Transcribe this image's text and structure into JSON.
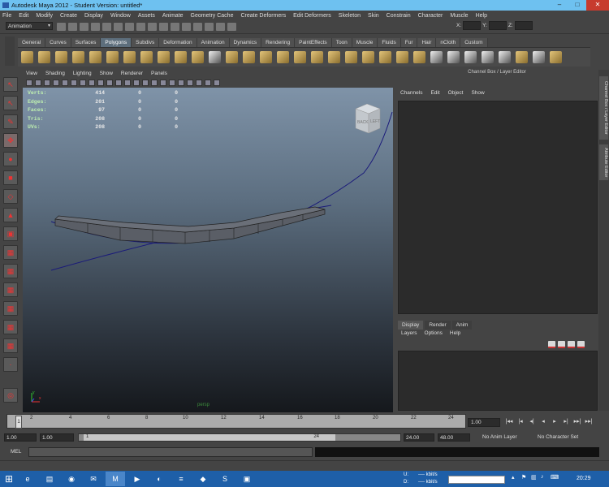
{
  "window": {
    "title": "Autodesk Maya 2012 - Student Version: untitled*",
    "min": "–",
    "max": "□",
    "close": "✕"
  },
  "menubar": [
    "File",
    "Edit",
    "Modify",
    "Create",
    "Display",
    "Window",
    "Assets",
    "Animate",
    "Geometry Cache",
    "Create Deformers",
    "Edit Deformers",
    "Skeleton",
    "Skin",
    "Constrain",
    "Character",
    "Muscle",
    "Help"
  ],
  "status": {
    "menu_set": "Animation",
    "x_label": "X:",
    "y_label": "Y:",
    "z_label": "Z:"
  },
  "shelf_tabs": [
    "General",
    "Curves",
    "Surfaces",
    "Polygons",
    "Subdivs",
    "Deformation",
    "Animation",
    "Dynamics",
    "Rendering",
    "PaintEffects",
    "Toon",
    "Muscle",
    "Fluids",
    "Fur",
    "Hair",
    "nCloth",
    "Custom"
  ],
  "shelf_active": "Polygons",
  "viewport": {
    "menu": [
      "View",
      "Shading",
      "Lighting",
      "Show",
      "Renderer",
      "Panels"
    ],
    "hud": [
      {
        "k": "Verts:",
        "v": [
          "414",
          "0",
          "0"
        ]
      },
      {
        "k": "Edges:",
        "v": [
          "201",
          "0",
          "0"
        ]
      },
      {
        "k": "Faces:",
        "v": [
          "97",
          "0",
          "0"
        ]
      },
      {
        "k": "Tris:",
        "v": [
          "208",
          "0",
          "0"
        ]
      },
      {
        "k": "UVs:",
        "v": [
          "208",
          "0",
          "0"
        ]
      }
    ],
    "cube_back": "BACK",
    "cube_left": "LEFT",
    "camera": "persp",
    "axis_y": "y",
    "axis_x": "x"
  },
  "channel_box": {
    "title": "Channel Box / Layer Editor",
    "menu": [
      "Channels",
      "Edit",
      "Object",
      "Show"
    ]
  },
  "side_tabs": [
    "Channel Box / Layer Editor",
    "Attribute Editor"
  ],
  "layer_editor": {
    "tabs": [
      "Display",
      "Render",
      "Anim"
    ],
    "active": "Display",
    "menu": [
      "Layers",
      "Options",
      "Help"
    ]
  },
  "timeline": {
    "ticks": [
      "1",
      "2",
      "4",
      "6",
      "8",
      "10",
      "12",
      "14",
      "16",
      "18",
      "20",
      "22",
      "24"
    ],
    "current_frame": "1.00",
    "playback": [
      "|◂◂",
      "|◂",
      "◂|",
      "◂",
      "▸",
      "▸|",
      "▸▸|",
      "▸▸|"
    ]
  },
  "range": {
    "start": "1.00",
    "inner_start": "1.00",
    "slider_left": "1",
    "slider_right": "24",
    "end_inner": "24.00",
    "end": "48.00",
    "anim_layer": "No Anim Layer",
    "character": "No Character Set"
  },
  "command": {
    "label": "MEL"
  },
  "taskbar": {
    "start": "⊞",
    "apps": [
      "e",
      "▤",
      "◉",
      "✉",
      "M",
      "▶",
      "◐",
      "≡",
      "◆",
      "S",
      "▣"
    ],
    "tray_u": "U:",
    "tray_d": "D:",
    "tray_up": "---- kbit/s",
    "tray_down": "---- kbit/s",
    "clock": "20:29"
  }
}
